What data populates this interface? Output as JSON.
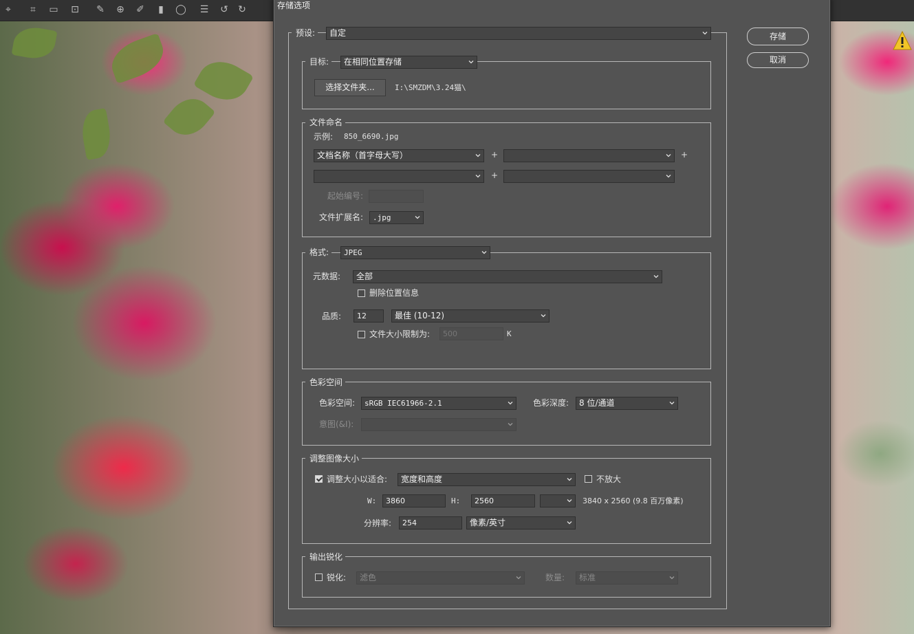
{
  "dialog": {
    "title": "存储选项",
    "save_button": "存储",
    "cancel_button": "取消",
    "preset": {
      "label": "预设:",
      "value": "自定"
    }
  },
  "destination": {
    "legend": "目标:",
    "value": "在相同位置存储",
    "choose_folder_button": "选择文件夹...",
    "path": "I:\\SMZDM\\3.24猫\\"
  },
  "file_naming": {
    "legend": "文件命名",
    "example_label": "示例:",
    "example_value": "850_6690.jpg",
    "field1": "文档名称（首字母大写）",
    "field2": "",
    "field3": "",
    "field4": "",
    "plus": "+",
    "start_number_label": "起始编号:",
    "start_number_value": "",
    "extension_label": "文件扩展名:",
    "extension_value": ".jpg"
  },
  "format": {
    "legend": "格式:",
    "value": "JPEG",
    "metadata_label": "元数据:",
    "metadata_value": "全部",
    "remove_location_label": "删除位置信息",
    "remove_location_checked": false,
    "quality_label": "品质:",
    "quality_value": "12",
    "quality_preset": "最佳  (10-12)",
    "limit_size_label": "文件大小限制为:",
    "limit_size_value": "500",
    "limit_size_unit": "K",
    "limit_size_checked": false
  },
  "color_space": {
    "legend": "色彩空间",
    "space_label": "色彩空间:",
    "space_value": "sRGB IEC61966-2.1",
    "depth_label": "色彩深度:",
    "depth_value": "8 位/通道",
    "intent_label": "意图(&I):",
    "intent_value": ""
  },
  "resize": {
    "legend": "调整图像大小",
    "fit_label": "调整大小以适合:",
    "fit_checked": true,
    "fit_value": "宽度和高度",
    "dont_enlarge_label": "不放大",
    "dont_enlarge_checked": false,
    "w_label": "W:",
    "w_value": "3860",
    "h_label": "H:",
    "h_value": "2560",
    "unit_value": "",
    "dimensions": "3840 x 2560 (9.8 百万像素)",
    "resolution_label": "分辨率:",
    "resolution_value": "254",
    "resolution_unit": "像素/英寸"
  },
  "sharpen": {
    "legend": "输出锐化",
    "sharpen_label": "锐化:",
    "sharpen_checked": false,
    "sharpen_value": "滤色",
    "amount_label": "数量:",
    "amount_value": "标准"
  }
}
